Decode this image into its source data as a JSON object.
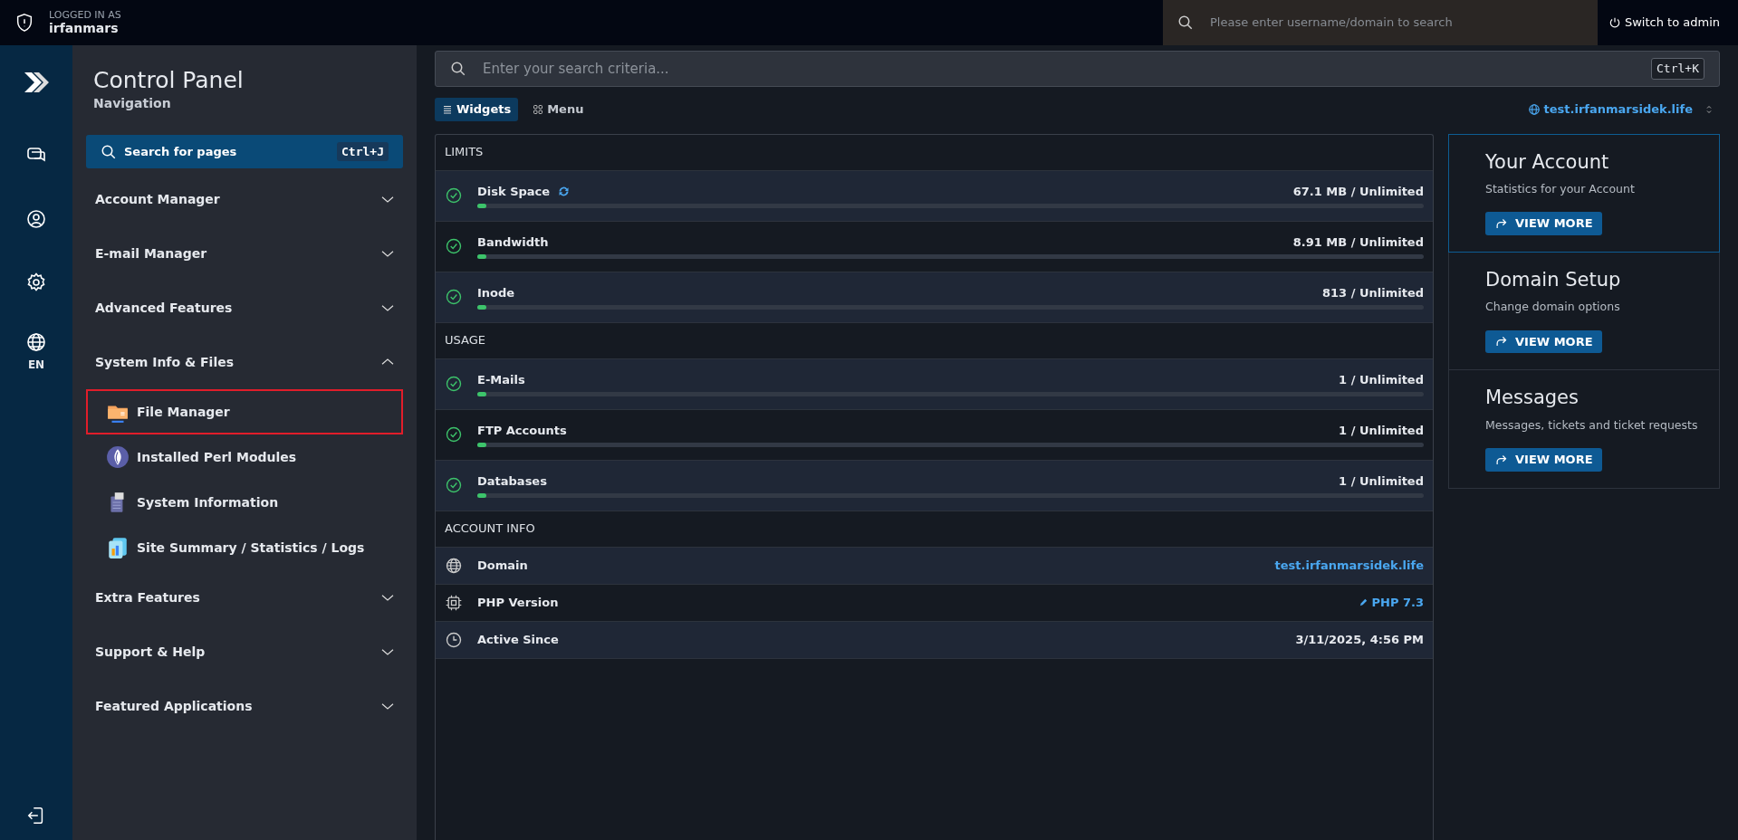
{
  "top_bar": {
    "logged_in_label": "LOGGED IN AS",
    "username": "irfanmars",
    "search": {
      "placeholder": "Please enter username/domain to search"
    },
    "switch_button": "Switch to admin"
  },
  "rail": {
    "language": "EN"
  },
  "sidebar": {
    "title": "Control Panel",
    "subtitle": "Navigation",
    "search": {
      "label": "Search for pages",
      "shortcut": "Ctrl+J"
    },
    "groups": [
      {
        "label": "Account Manager",
        "expanded": false
      },
      {
        "label": "E-mail Manager",
        "expanded": false
      },
      {
        "label": "Advanced Features",
        "expanded": false
      },
      {
        "label": "System Info & Files",
        "expanded": true,
        "children": [
          {
            "label": "File Manager",
            "selected": true
          },
          {
            "label": "Installed Perl Modules",
            "selected": false
          },
          {
            "label": "System Information",
            "selected": false
          },
          {
            "label": "Site Summary / Statistics / Logs",
            "selected": false
          }
        ]
      },
      {
        "label": "Extra Features",
        "expanded": false
      },
      {
        "label": "Support & Help",
        "expanded": false
      },
      {
        "label": "Featured Applications",
        "expanded": false
      }
    ]
  },
  "main": {
    "search": {
      "placeholder": "Enter your search criteria...",
      "shortcut": "Ctrl+K"
    },
    "view_tabs": [
      {
        "label": "Widgets",
        "selected": true
      },
      {
        "label": "Menu",
        "selected": false
      }
    ],
    "domain_selector": "test.irfanmarsidek.life",
    "sections": [
      {
        "title": "LIMITS",
        "rows": [
          {
            "kind": "meter",
            "label": "Disk Space",
            "refresh": true,
            "reading": "67.1 MB / Unlimited",
            "level": 0.01
          },
          {
            "kind": "meter",
            "label": "Bandwidth",
            "reading": "8.91 MB / Unlimited",
            "level": 0.01
          },
          {
            "kind": "meter",
            "label": "Inode",
            "reading": "813 / Unlimited",
            "level": 0.01
          }
        ]
      },
      {
        "title": "USAGE",
        "rows": [
          {
            "kind": "meter",
            "label": "E-Mails",
            "reading": "1 / Unlimited",
            "level": 0.01
          },
          {
            "kind": "meter",
            "label": "FTP Accounts",
            "reading": "1 / Unlimited",
            "level": 0.01
          },
          {
            "kind": "meter",
            "label": "Databases",
            "reading": "1 / Unlimited",
            "level": 0.01
          }
        ]
      },
      {
        "title": "ACCOUNT INFO",
        "rows": [
          {
            "kind": "link",
            "label": "Domain",
            "value": "test.irfanmarsidek.life"
          },
          {
            "kind": "editable",
            "label": "PHP Version",
            "value": "PHP 7.3"
          },
          {
            "kind": "text",
            "label": "Active Since",
            "value": "3/11/2025, 4:56 PM"
          }
        ]
      }
    ]
  },
  "cards": [
    {
      "title": "Your Account",
      "description": "Statistics for your Account",
      "button": "VIEW MORE",
      "selected": true
    },
    {
      "title": "Domain Setup",
      "description": "Change domain options",
      "button": "VIEW MORE",
      "selected": false
    },
    {
      "title": "Messages",
      "description": "Messages, tickets and ticket requests",
      "button": "VIEW MORE",
      "selected": false
    }
  ]
}
